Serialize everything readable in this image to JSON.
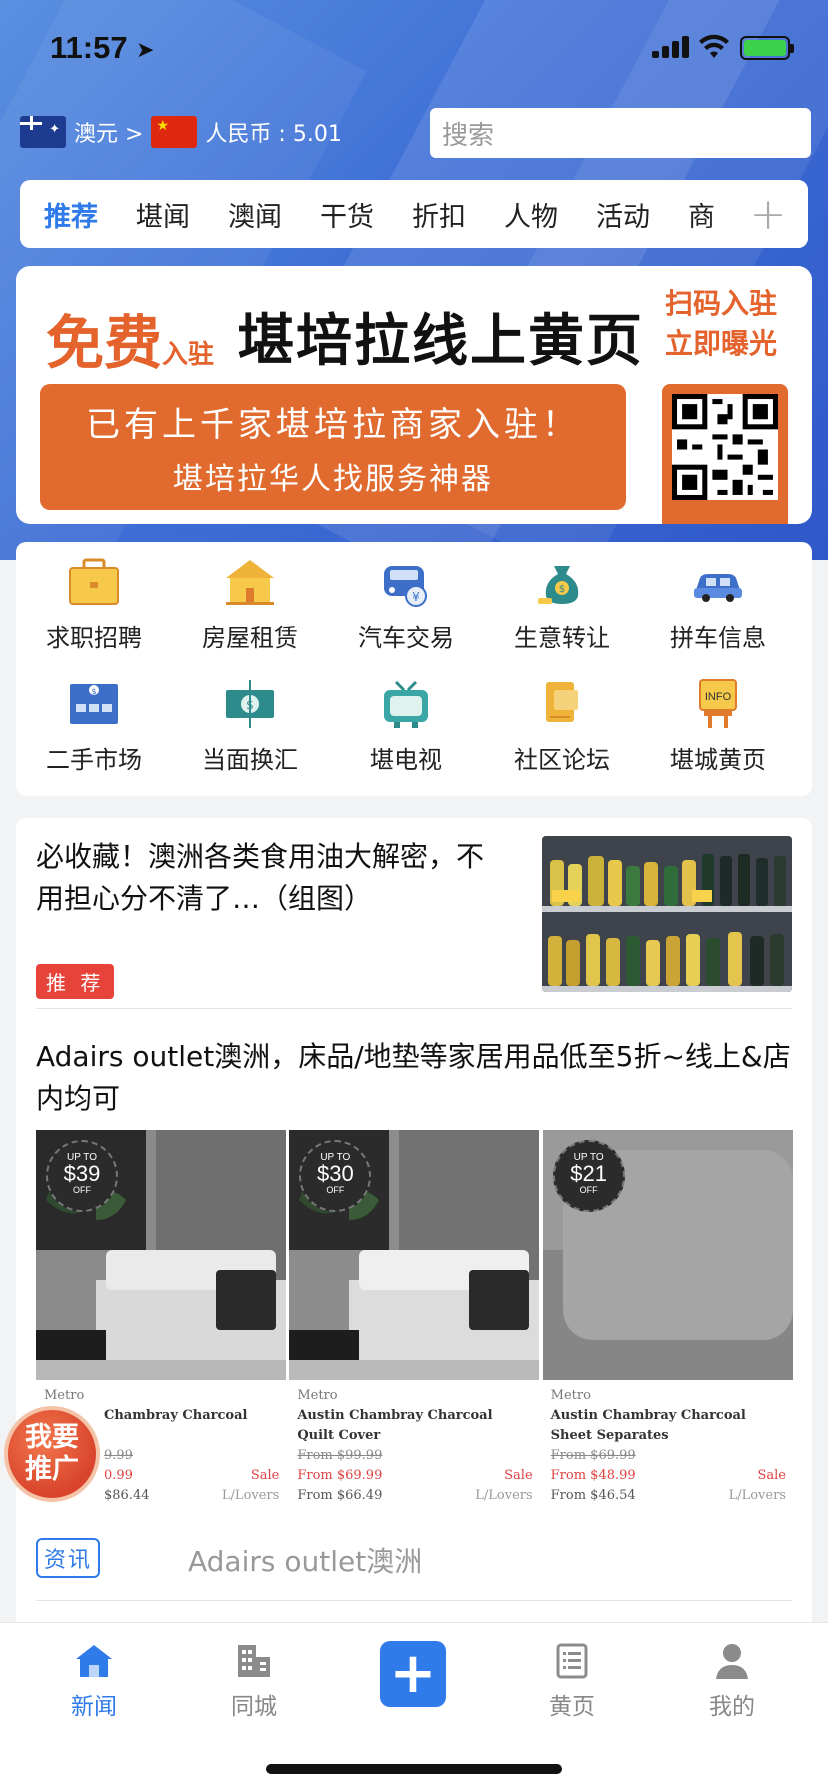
{
  "status_bar": {
    "time": "11:57",
    "location_glyph": "➤"
  },
  "currency": {
    "from": "澳元 >",
    "to": "人民币 : 5.01"
  },
  "search": {
    "placeholder": "搜索"
  },
  "tabs": {
    "items": [
      "推荐",
      "堪闻",
      "澳闻",
      "干货",
      "折扣",
      "人物",
      "活动",
      "商"
    ],
    "active": "推荐",
    "more": "+"
  },
  "banner": {
    "free": "免费",
    "free_suffix": "入驻",
    "headline": "堪培拉线上黄页",
    "scan": [
      "扫码入驻",
      "立即曝光"
    ],
    "line1": "已有上千家堪培拉商家入驻！",
    "line2": "堪培拉华人找服务神器"
  },
  "categories": [
    {
      "label": "求职招聘",
      "icon": "briefcase-icon"
    },
    {
      "label": "房屋租赁",
      "icon": "house-icon"
    },
    {
      "label": "汽车交易",
      "icon": "car-trade-icon"
    },
    {
      "label": "生意转让",
      "icon": "money-bag-icon"
    },
    {
      "label": "拼车信息",
      "icon": "carpool-icon"
    },
    {
      "label": "二手市场",
      "icon": "market-icon"
    },
    {
      "label": "当面换汇",
      "icon": "exchange-icon"
    },
    {
      "label": "堪电视",
      "icon": "tv-icon"
    },
    {
      "label": "社区论坛",
      "icon": "forum-icon"
    },
    {
      "label": "堪城黄页",
      "icon": "info-sign-icon"
    }
  ],
  "articles": [
    {
      "title": "必收藏！澳洲各类食用油大解密，不用担心分不清了…（组图）",
      "tag": "推 荐"
    },
    {
      "title": "Adairs outlet澳洲，床品/地垫等家居用品低至5折~线上&店内均可",
      "tag": "资讯",
      "source": "Adairs outlet澳洲",
      "products": [
        {
          "badge_top": "UP TO",
          "badge_amount": "$39",
          "badge_bottom": "OFF",
          "brand": "Metro",
          "name": "Chambray Charcoal",
          "was": "9.99",
          "now": "0.99",
          "sale": "Sale",
          "from": "$86.44",
          "lovers": "L/Lovers"
        },
        {
          "badge_top": "UP TO",
          "badge_amount": "$30",
          "badge_bottom": "OFF",
          "brand": "Metro",
          "name": "Austin Chambray Charcoal Quilt Cover",
          "was": "From $99.99",
          "now": "From $69.99",
          "sale": "Sale",
          "from": "From $66.49",
          "lovers": "L/Lovers"
        },
        {
          "badge_top": "UP TO",
          "badge_amount": "$21",
          "badge_bottom": "OFF",
          "brand": "Metro",
          "name": "Austin Chambray Charcoal Sheet Separates",
          "was": "From $69.99",
          "now": "From $48.99",
          "sale": "Sale",
          "from": "From $46.54",
          "lovers": "L/Lovers"
        }
      ]
    }
  ],
  "promote": {
    "line1": "我要",
    "line2": "推广"
  },
  "tabbar": [
    {
      "label": "新闻",
      "icon": "news-home-icon",
      "active": true
    },
    {
      "label": "同城",
      "icon": "city-buildings-icon",
      "active": false
    },
    {
      "label": "",
      "icon": "plus-icon",
      "active": false
    },
    {
      "label": "黄页",
      "icon": "yellow-pages-icon",
      "active": false
    },
    {
      "label": "我的",
      "icon": "profile-icon",
      "active": false
    }
  ],
  "colors": {
    "accent": "#2f7bea",
    "banner_orange": "#e16a2e",
    "tag_red": "#e6443a"
  }
}
